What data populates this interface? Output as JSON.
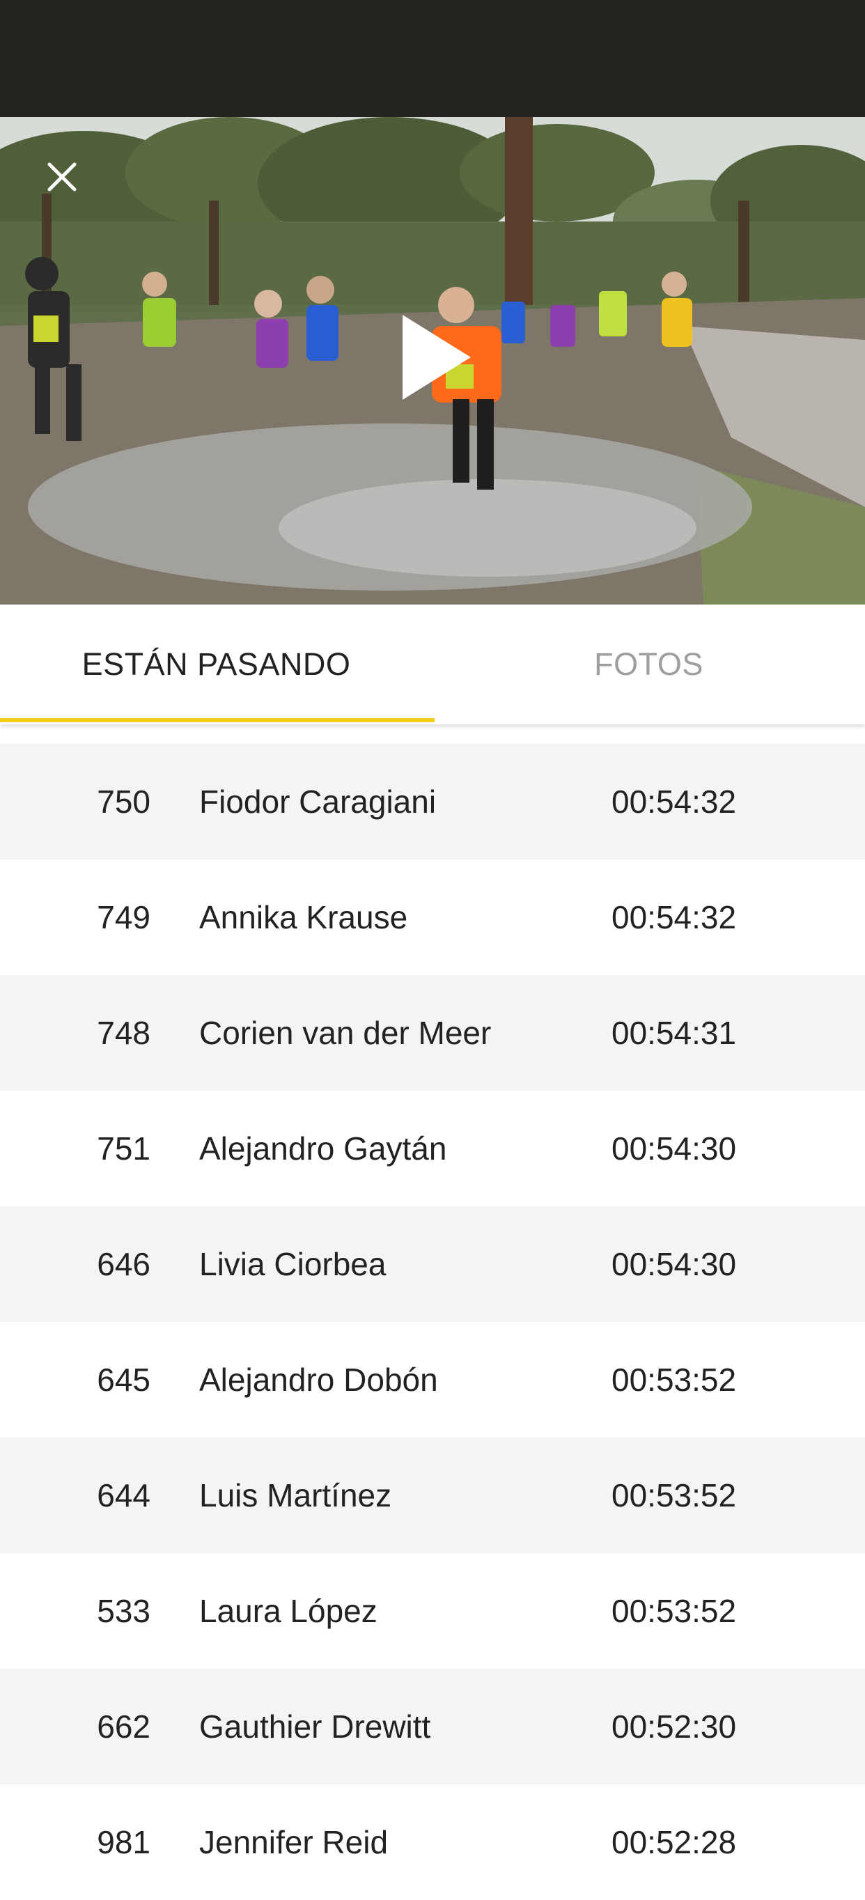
{
  "header": {
    "close_icon": "close-icon",
    "play_icon": "play-icon"
  },
  "tabs": [
    {
      "label": "ESTÁN PASANDO",
      "active": true
    },
    {
      "label": "FOTOS",
      "active": false
    }
  ],
  "colors": {
    "accent": "#f2cf1d",
    "status_bar": "#23221e",
    "row_shaded": "#f4f4f4",
    "text": "#222222",
    "inactive_tab": "#9e9e9e"
  },
  "runners": [
    {
      "bib": "750",
      "name": "Fiodor Caragiani",
      "time": "00:54:32"
    },
    {
      "bib": "749",
      "name": "Annika Krause",
      "time": "00:54:32"
    },
    {
      "bib": "748",
      "name": "Corien van der Meer",
      "time": "00:54:31"
    },
    {
      "bib": "751",
      "name": "Alejandro Gaytán",
      "time": "00:54:30"
    },
    {
      "bib": "646",
      "name": "Livia Ciorbea",
      "time": "00:54:30"
    },
    {
      "bib": "645",
      "name": "Alejandro Dobón",
      "time": "00:53:52"
    },
    {
      "bib": "644",
      "name": "Luis Martínez",
      "time": "00:53:52"
    },
    {
      "bib": "533",
      "name": "Laura López",
      "time": "00:53:52"
    },
    {
      "bib": "662",
      "name": "Gauthier Drewitt",
      "time": "00:52:30"
    },
    {
      "bib": "981",
      "name": "Jennifer Reid",
      "time": "00:52:28"
    }
  ]
}
